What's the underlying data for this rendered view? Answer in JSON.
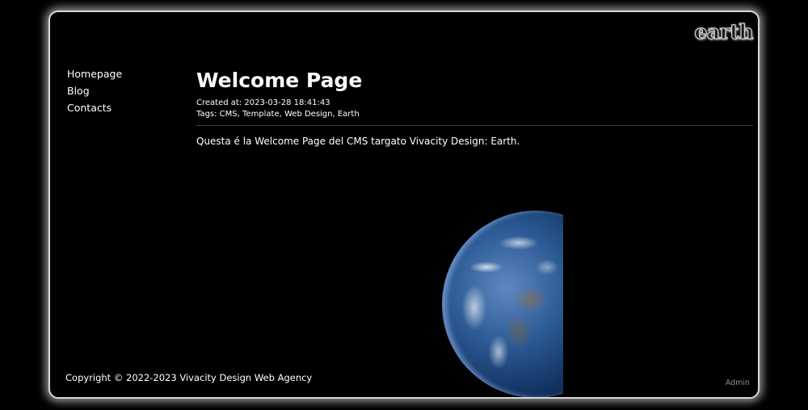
{
  "logo": "earth",
  "nav": {
    "items": [
      {
        "label": "Homepage"
      },
      {
        "label": "Blog"
      },
      {
        "label": "Contacts"
      }
    ]
  },
  "page": {
    "title": "Welcome Page",
    "created": "Created at: 2023-03-28 18:41:43",
    "tags": "Tags: CMS, Template, Web Design, Earth",
    "body": "Questa é la Welcome Page del CMS targato Vivacity Design: Earth."
  },
  "footer": {
    "copyright": "Copyright © 2022-2023 Vivacity Design Web Agency",
    "admin_label": "Admin"
  },
  "colors": {
    "background": "#000000",
    "frame_border": "#d8d8d8",
    "text": "#ffffff",
    "admin_link": "#8a8a8a"
  }
}
